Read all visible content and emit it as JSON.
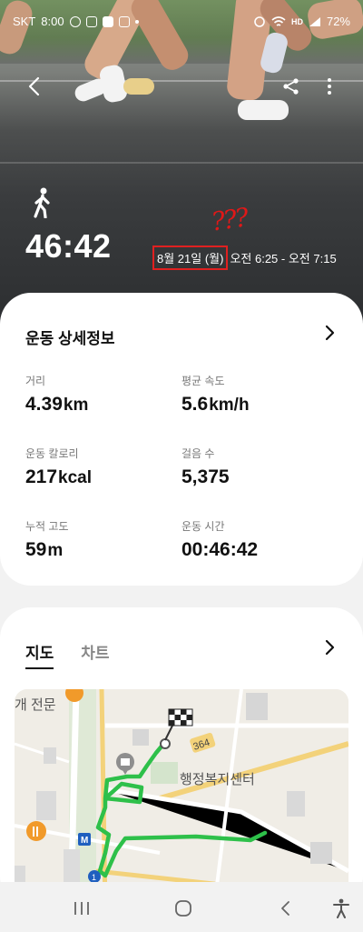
{
  "status_bar": {
    "carrier": "SKT",
    "time": "8:00",
    "battery": "72%"
  },
  "header": {
    "duration": "46:42",
    "date": "8월 21일 (월)",
    "time_range": "오전 6:25 - 오전 7:15",
    "annotation": "???"
  },
  "details": {
    "title": "운동 상세정보",
    "metrics": [
      {
        "label": "거리",
        "value": "4.39",
        "unit": "km"
      },
      {
        "label": "평균 속도",
        "value": "5.6",
        "unit": "km/h"
      },
      {
        "label": "운동 칼로리",
        "value": "217",
        "unit": "kcal"
      },
      {
        "label": "걸음 수",
        "value": "5,375",
        "unit": ""
      },
      {
        "label": "누적 고도",
        "value": "59",
        "unit": "m"
      },
      {
        "label": "운동 시간",
        "value": "00:46:42",
        "unit": ""
      }
    ]
  },
  "map_section": {
    "tabs": [
      "지도",
      "차트"
    ],
    "active_tab": "지도",
    "map_labels": {
      "place": "행정복지센터",
      "store_partial": "개 전문",
      "road_number": "364",
      "route_number": "1",
      "metro": "M"
    }
  },
  "colors": {
    "route": "#2ec04a",
    "accent_red": "#e02020"
  }
}
